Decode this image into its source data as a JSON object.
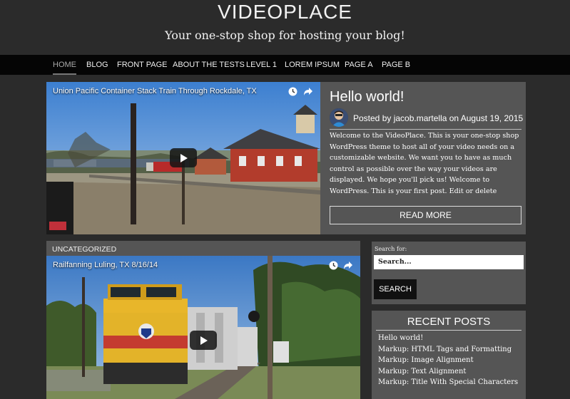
{
  "site": {
    "title": "VIDEOPLACE",
    "tagline": "Your one-stop shop for hosting your blog!"
  },
  "nav": {
    "items": [
      "HOME",
      "BLOG",
      "FRONT PAGE",
      "ABOUT THE TESTS",
      "LEVEL 1",
      "LOREM IPSUM",
      "PAGE A",
      "PAGE B"
    ],
    "active": "HOME"
  },
  "featured_post": {
    "video_title": "Union Pacific Container Stack Train Through Rockdale, TX",
    "title": "Hello world!",
    "meta": "Posted by jacob.martella on August 19, 2015",
    "excerpt": "Welcome to the VideoPlace. This is your one-stop shop WordPress theme to host all of  your video needs on a customizable website. We want you to have as much control as possible over the way your videos are displayed. We hope you'll pick us! Welcome to WordPress. This is your first post. Edit or delete",
    "read_more": "READ MORE"
  },
  "second_post": {
    "category": "UNCATEGORIZED",
    "video_title": "Railfanning Luling, TX 8/16/14"
  },
  "sidebar": {
    "search": {
      "label": "Search for:",
      "placeholder": "Search...",
      "button": "SEARCH"
    },
    "recent_posts": {
      "heading": "RECENT POSTS",
      "items": [
        "Hello world!",
        "Markup: HTML Tags and Formatting",
        "Markup: Image Alignment",
        "Markup: Text Alignment",
        "Markup: Title With Special Characters"
      ]
    }
  },
  "icons": [
    "clock-icon",
    "share-icon",
    "play-icon",
    "avatar"
  ],
  "colors": {
    "background": "#2b2b2b",
    "nav_background": "#050505",
    "panel": "#555555",
    "text": "#ffffff"
  }
}
